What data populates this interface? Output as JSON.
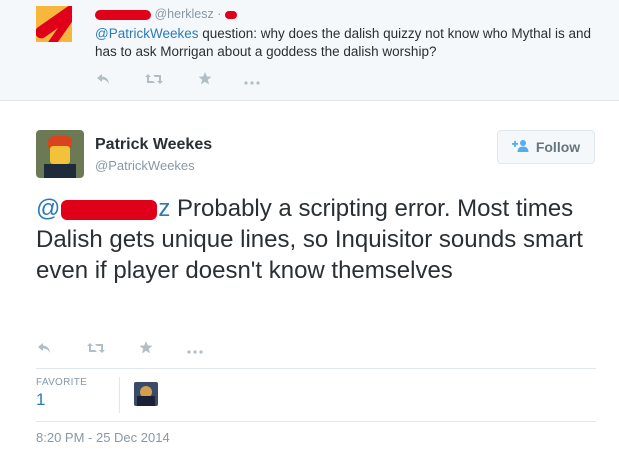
{
  "reply_tweet": {
    "handle": "@herklesz",
    "dot": "·",
    "mention": "@PatrickWeekes",
    "text": " question: why does the dalish quizzy not know who Mythal is and has to ask Morrigan about a goddess the dalish worship?"
  },
  "main_tweet": {
    "author_name": "Patrick Weekes",
    "author_handle": "@PatrickWeekes",
    "follow_label": "Follow",
    "mention": "@",
    "mention_end": "z",
    "text": " Probably a scripting error. Most times Dalish gets unique lines, so Inquisitor sounds smart even if player doesn't know themselves",
    "favorite_label": "FAVORITE",
    "favorite_count": "1",
    "timestamp": "8:20 PM - 25 Dec 2014"
  },
  "icons": {
    "reply": "reply-icon",
    "retweet": "retweet-icon",
    "favorite": "star-icon",
    "more": "more-icon",
    "follow": "add-person-icon"
  },
  "colors": {
    "link": "#2b7bb9",
    "muted": "#8899a6",
    "redaction": "#e0001a",
    "follow_accent": "#55acee"
  }
}
